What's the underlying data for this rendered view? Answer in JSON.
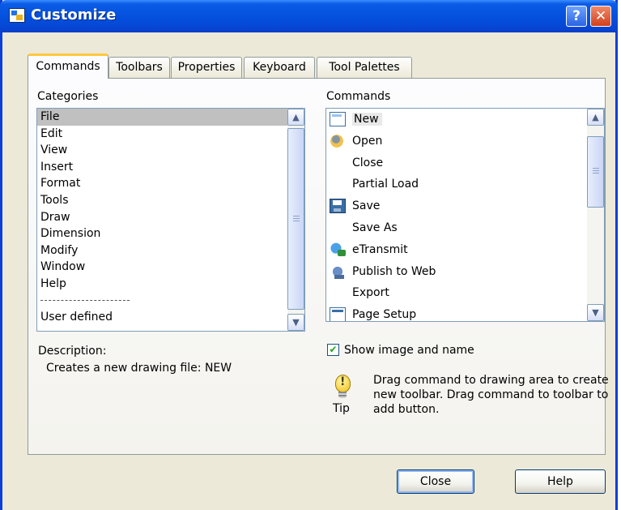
{
  "window": {
    "title": "Customize",
    "help_button": "?",
    "close_button": "✕"
  },
  "tabs": [
    {
      "label": "Commands",
      "active": true
    },
    {
      "label": "Toolbars",
      "active": false
    },
    {
      "label": "Properties",
      "active": false
    },
    {
      "label": "Keyboard",
      "active": false
    },
    {
      "label": "Tool Palettes",
      "active": false
    }
  ],
  "categories": {
    "label": "Categories",
    "items": [
      "File",
      "Edit",
      "View",
      "Insert",
      "Format",
      "Tools",
      "Draw",
      "Dimension",
      "Modify",
      "Window",
      "Help"
    ],
    "separator": "----------------------------",
    "user_defined": "User defined",
    "selected": "File"
  },
  "commands": {
    "label": "Commands",
    "items": [
      {
        "label": "New",
        "icon": "new-document-icon",
        "selected": true
      },
      {
        "label": "Open",
        "icon": "open-folder-icon"
      },
      {
        "label": "Close",
        "icon": ""
      },
      {
        "label": "Partial Load",
        "icon": ""
      },
      {
        "label": "Save",
        "icon": "floppy-disk-icon"
      },
      {
        "label": "Save As",
        "icon": ""
      },
      {
        "label": "eTransmit",
        "icon": "etransmit-icon"
      },
      {
        "label": "Publish to Web",
        "icon": "publish-web-icon"
      },
      {
        "label": "Export",
        "icon": ""
      },
      {
        "label": "Page Setup",
        "icon": "page-setup-icon"
      }
    ]
  },
  "description": {
    "label": "Description:",
    "text": "Creates a new drawing file:  NEW"
  },
  "options": {
    "show_image_and_name": {
      "label": "Show image and name",
      "checked": true
    }
  },
  "tip": {
    "label": "Tip",
    "text": "Drag command to drawing area to create new toolbar. Drag command to toolbar to add button."
  },
  "buttons": {
    "close": "Close",
    "help": "Help"
  },
  "colors": {
    "titlebar": "#0451dd",
    "dialog_bg": "#ece9d8",
    "tab_highlight": "#ffc83c",
    "selection_gray": "#c0c0c0"
  }
}
